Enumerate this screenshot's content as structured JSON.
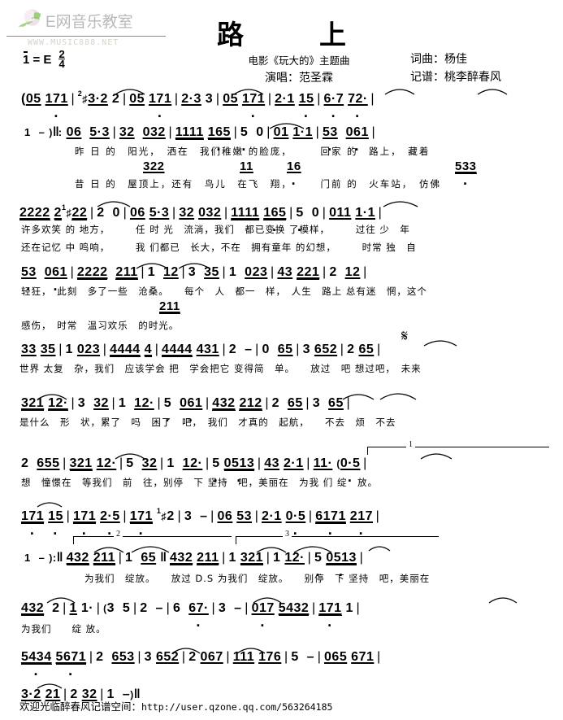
{
  "watermark": {
    "brand": "E网音乐教室",
    "url": "WWW.MUSIC888.NET",
    "icon": "flower-logo-icon"
  },
  "key_signature": {
    "tonic_label": "1 = E",
    "meter_numerator": "2",
    "meter_denominator": "4"
  },
  "header": {
    "title": "路　上",
    "film_line": "电影《玩大的》主题曲",
    "singer_line": "演唱：范圣霖",
    "lyricist_line": "词曲：杨佳",
    "transcriber_line": "记谱：桃李醉春风"
  },
  "score": {
    "lines": [
      {
        "id": "line-1",
        "notes": "( 05 171 | ♯3·2 2 | 05 171 | 2·3 3 | 05 171 | 2·1 15 | 6·7 72· |",
        "lyrics": ""
      },
      {
        "id": "line-2",
        "notes": "1 - ) ‖: 06 5·3 | 32 032 | 1111 165 | 5 0 | 01 1·1 | 53 061 |",
        "lyrics": "昨 日 的　阳光，　洒在　我们稚嫩 的脸庞，　　　回家 的　路上，　藏着",
        "notes2": "322　　11　16　　　　533",
        "lyrics2": "昔 日 的　屋顶上，还有　鸟儿　在飞　翔，　　　门前 的　火车站，　仿佛"
      },
      {
        "id": "line-3",
        "notes": "2222 2·22 | 2 0 | 06 5·3 | 32 032 | 1111 165 | 5 0 | 011 1·1 |",
        "lyrics": "许多欢笑 的 地方，　　　任 时 光　流淌，我们　都已变换 了模样，　　　过往 少　年",
        "lyrics2": "还在记忆 中 鸣响，　　　我 们都已　长大，不在　拥有童年 的幻想，　　　时常 独　自"
      },
      {
        "id": "line-4",
        "notes": "53 061 | 2222 211 | 1 12 | 3 35 | 1 023 | 43 221 | 2 12 |",
        "lyrics": "轻狂，　此刻　多了一些　沧桑。　　每个　人　都一　样，　人生　路上 总有迷　惘，这个",
        "notes2": "211",
        "lyrics2": "感伤，　时常　温习欢乐　的时光。"
      },
      {
        "id": "line-5",
        "notes": "33 35 | 1 023 | 4444 4 | 4444 431 | 2 - | 0 65 | 3 652 | 2 65 |",
        "lyrics": "世界 太复　杂，我们　应该学会 把　学会把它 变得简　单。　　放过　吧 想过吧，　未来"
      },
      {
        "id": "line-6",
        "notes": "321 12· | 3 32 | 1 12· | 5 061 | 432 212 | 2 65 | 3 65 |",
        "lyrics": "是什么　形　状，累了　吗　困了　吧，　我们　才真的　起航，　　不去　烦　不去"
      },
      {
        "id": "line-7",
        "notes": "2 655 | 321 12· | 5 32 | 1 12· | 5 0513 | 43 2·1 | 11· ( 0·5 |",
        "lyrics": "想　憧憬在　等我们　前　往，别停　下 坚持　吧，美丽在　为我 们 绽　放。"
      },
      {
        "id": "line-8",
        "notes": "171 15 | 171 2·5 | 171 ♯2 | 3 - | 06 53 | 2·1 0·5 | 6171 217 |",
        "lyrics": ""
      },
      {
        "id": "line-9",
        "notes": "1 - ) :‖ 432 211 | 1 65 ‖ 432 211 | 1 321 | 1 12· | 5 0513 |",
        "lyrics": "为我们　绽放。　　放过 D.S 为我们　绽放。　　别停　下 坚持　吧，美丽在",
        "volta_left": "2",
        "volta_right": "3"
      },
      {
        "id": "line-10",
        "notes": "432 2 | 1 1· | ( 3 5 | 2 - | 6 67· | 3 - | 017 5432 | 171 1 |",
        "lyrics": "为我们　　绽 放。"
      },
      {
        "id": "line-11",
        "notes": "5434 5671 | 2 653 | 3 652 | 2 067 | 111 176 | 5 - | 065 671 |",
        "lyrics": ""
      },
      {
        "id": "line-12",
        "notes": "3·2 21 | 2 32 | 1 - ) ‖",
        "lyrics": ""
      }
    ]
  },
  "annotations": {
    "segno": "𝄋",
    "ds_mark": "D.S",
    "volta_1": "1",
    "volta_2": "2",
    "volta_3": "3"
  },
  "footer": {
    "text": "欢迎光临醉春风记谱空间：",
    "url": "http://user.qzone.qq.com/563264185"
  }
}
